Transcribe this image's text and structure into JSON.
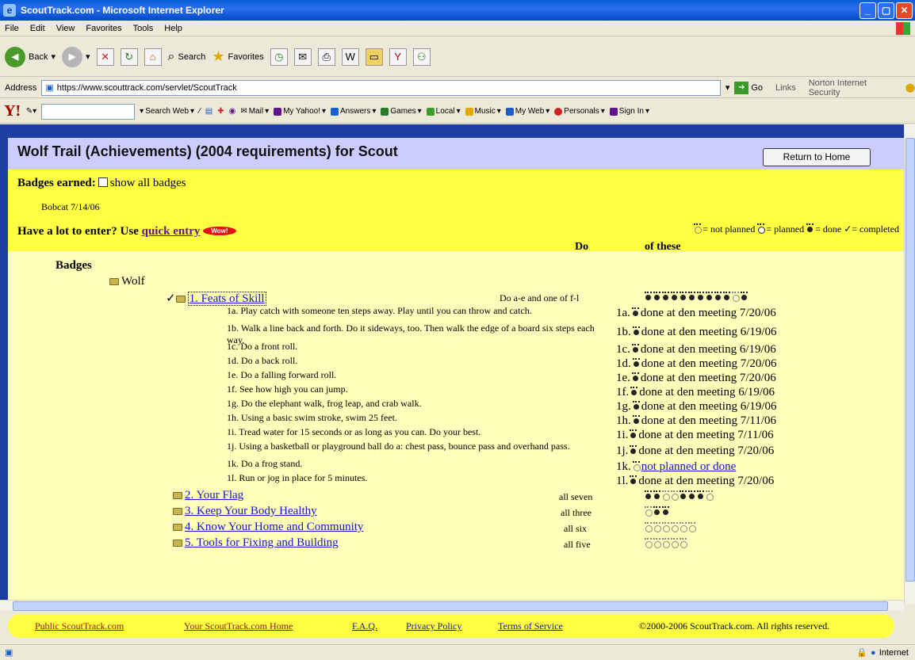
{
  "window": {
    "title": "ScoutTrack.com - Microsoft Internet Explorer",
    "btn_min": "_",
    "btn_max": "▢",
    "btn_close": "✕"
  },
  "menu": [
    "File",
    "Edit",
    "View",
    "Favorites",
    "Tools",
    "Help"
  ],
  "toolbar": {
    "back": "Back",
    "search": "Search",
    "favorites": "Favorites"
  },
  "address": {
    "label": "Address",
    "url": "https://www.scouttrack.com/servlet/ScoutTrack",
    "go": "Go",
    "links": "Links",
    "norton": "Norton Internet Security"
  },
  "yahoo": {
    "logo": "Y!",
    "search_web": "Search Web",
    "items": [
      "Mail",
      "My Yahoo!",
      "Answers",
      "Games",
      "Local",
      "Music",
      "My Web",
      "Personals",
      "Sign In"
    ]
  },
  "page": {
    "title": "Wolf Trail (Achievements) (2004 requirements) for Scout",
    "return_home": "Return to Home",
    "badges_earned_label": "Badges earned:",
    "show_all_badges": "show all badges",
    "bobcat": "Bobcat 7/14/06",
    "lot_to_enter": "Have a lot to enter? Use ",
    "quick_entry": "quick entry",
    "wow": "Wow!",
    "legend_not_planned": "= not planned",
    "legend_planned": "= planned",
    "legend_done": "= done",
    "legend_completed": "= completed",
    "col_do": "Do",
    "col_of_these": "of these",
    "badges_heading": "Badges",
    "wolf": "Wolf"
  },
  "feat": {
    "label": "1. Feats of Skill",
    "do": "Do a-e and one of f-l",
    "prints": [
      "done",
      "done",
      "done",
      "done",
      "done",
      "done",
      "done",
      "done",
      "done",
      "done",
      "np",
      "done"
    ]
  },
  "requirements": [
    {
      "text": "1a. Play catch with someone ten steps away. Play until you can throw and catch.",
      "status_id": "1a.",
      "status": "done at den meeting 7/20/06",
      "state": "done"
    },
    {
      "text": "1b. Walk a line back and forth. Do it sideways, too. Then walk the edge of a board six steps each way.",
      "status_id": "1b.",
      "status": "done at den meeting 6/19/06",
      "state": "done"
    },
    {
      "text": "1c. Do a front roll.",
      "status_id": "1c.",
      "status": "done at den meeting 6/19/06",
      "state": "done"
    },
    {
      "text": "1d. Do a back roll.",
      "status_id": "1d.",
      "status": "done at den meeting 7/20/06",
      "state": "done"
    },
    {
      "text": "1e. Do a falling forward roll.",
      "status_id": "1e.",
      "status": "done at den meeting 7/20/06",
      "state": "done"
    },
    {
      "text": "1f. See how high you can jump.",
      "status_id": "1f.",
      "status": "done at den meeting 6/19/06",
      "state": "done"
    },
    {
      "text": "1g. Do the elephant walk, frog leap, and crab walk.",
      "status_id": "1g.",
      "status": "done at den meeting 6/19/06",
      "state": "done"
    },
    {
      "text": "1h. Using a basic swim stroke, swim 25 feet.",
      "status_id": "1h.",
      "status": "done at den meeting 7/11/06",
      "state": "done"
    },
    {
      "text": "1i. Tread water for 15 seconds or as long as you can. Do your best.",
      "status_id": "1i.",
      "status": "done at den meeting 7/11/06",
      "state": "done"
    },
    {
      "text": "1j. Using a basketball or playground ball do a: chest pass, bounce pass and overhand pass.",
      "status_id": "1j.",
      "status": "done at den meeting 7/20/06",
      "state": "done"
    },
    {
      "text": "1k. Do a frog stand.",
      "status_id": "1k.",
      "status": "not planned or done",
      "state": "np"
    },
    {
      "text": "1l. Run or jog in place for 5 minutes.",
      "status_id": "1l.",
      "status": "done at den meeting 7/20/06",
      "state": "done"
    }
  ],
  "badges": [
    {
      "label": "2. Your Flag",
      "do": "all seven",
      "prints": [
        "done",
        "done",
        "np",
        "np",
        "done",
        "done",
        "done",
        "np"
      ]
    },
    {
      "label": "3. Keep Your Body Healthy",
      "do": "all three",
      "prints": [
        "np",
        "done",
        "done"
      ]
    },
    {
      "label": "4. Know Your Home and Community",
      "do": "all six",
      "prints": [
        "np",
        "np",
        "np",
        "np",
        "np",
        "np"
      ]
    },
    {
      "label": "5. Tools for Fixing and Building",
      "do": "all five",
      "prints": [
        "np",
        "np",
        "np",
        "np",
        "np"
      ]
    }
  ],
  "footer": {
    "public": "Public ScoutTrack.com",
    "home": "Your ScoutTrack.com Home",
    "faq": "F.A.Q.",
    "privacy": "Privacy Policy",
    "terms": "Terms of Service",
    "copyright": "©2000-2006 ScoutTrack.com. All rights reserved."
  },
  "status": {
    "zone": "Internet"
  }
}
